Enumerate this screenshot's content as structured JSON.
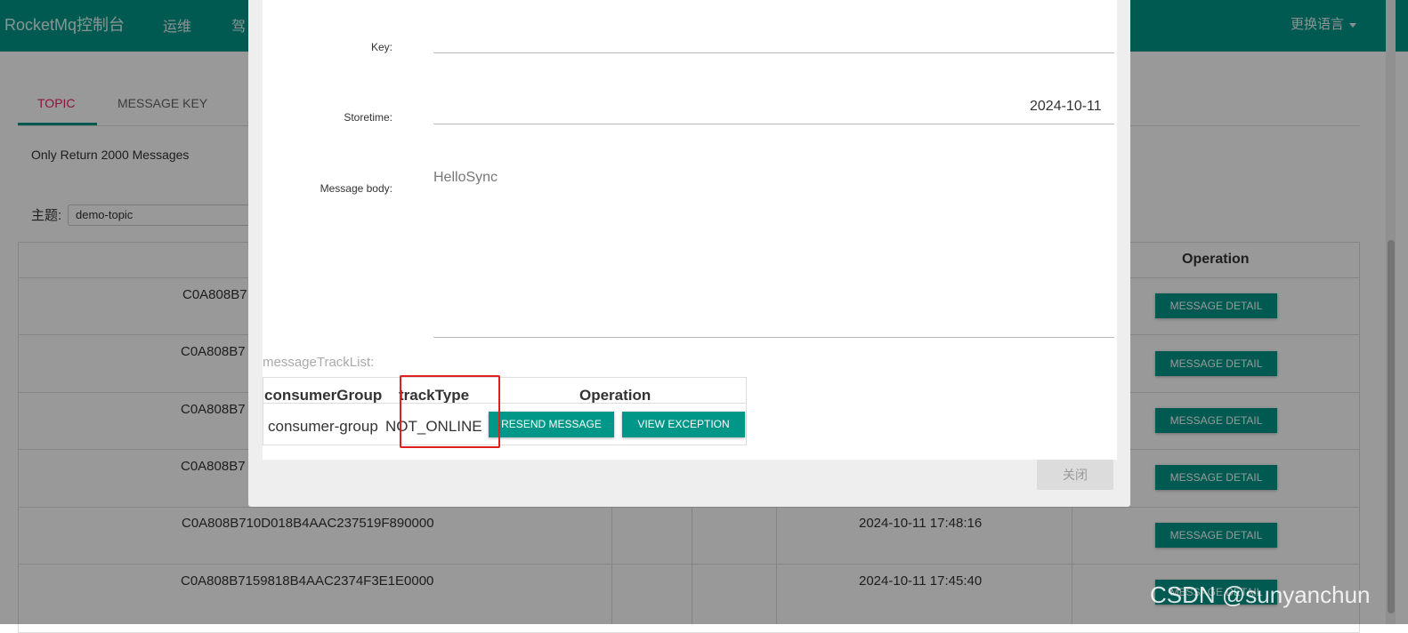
{
  "navbar": {
    "brand": "RocketMq控制台",
    "items": [
      "运维",
      "驾"
    ],
    "language": "更换语言"
  },
  "tabs": [
    {
      "label": "TOPIC",
      "active": true
    },
    {
      "label": "MESSAGE KEY",
      "active": false
    }
  ],
  "notice": "Only Return 2000 Messages",
  "topic_filter": {
    "label": "主题:",
    "value": "demo-topic"
  },
  "message_table": {
    "operation_header": "Operation",
    "rows": [
      {
        "id": "C0A808B7",
        "time": "",
        "action": "MESSAGE DETAIL"
      },
      {
        "id": "C0A808B7",
        "time": "",
        "action": "MESSAGE DETAIL"
      },
      {
        "id": "C0A808B7",
        "time": "",
        "action": "MESSAGE DETAIL"
      },
      {
        "id": "C0A808B7",
        "time": "",
        "action": "MESSAGE DETAIL"
      },
      {
        "id": "C0A808B710D018B4AAC237519F890000",
        "time": "2024-10-11 17:48:16",
        "action": "MESSAGE DETAIL"
      },
      {
        "id": "C0A808B7159818B4AAC2374F3E1E0000",
        "time": "2024-10-11 17:45:40",
        "action": "MESSAGE DETAIL"
      }
    ]
  },
  "modal": {
    "key_label": "Key:",
    "key_value": "",
    "storetime_label": "Storetime:",
    "storetime_value": "2024-10-11",
    "body_label": "Message body:",
    "body_value": "HelloSync",
    "track_list_label": "messageTrackList:",
    "track_table": {
      "headers": [
        "consumerGroup",
        "trackType",
        "Operation"
      ],
      "rows": [
        {
          "consumerGroup": "consumer-group",
          "trackType": "NOT_ONLINE",
          "resend": "RESEND MESSAGE",
          "view": "VIEW EXCEPTION"
        }
      ]
    },
    "close_label": "关闭"
  },
  "watermark": "CSDN @sunyanchun",
  "colors": {
    "primary": "#009688",
    "highlight": "#e0201e",
    "active_tab": "#e91e63"
  }
}
